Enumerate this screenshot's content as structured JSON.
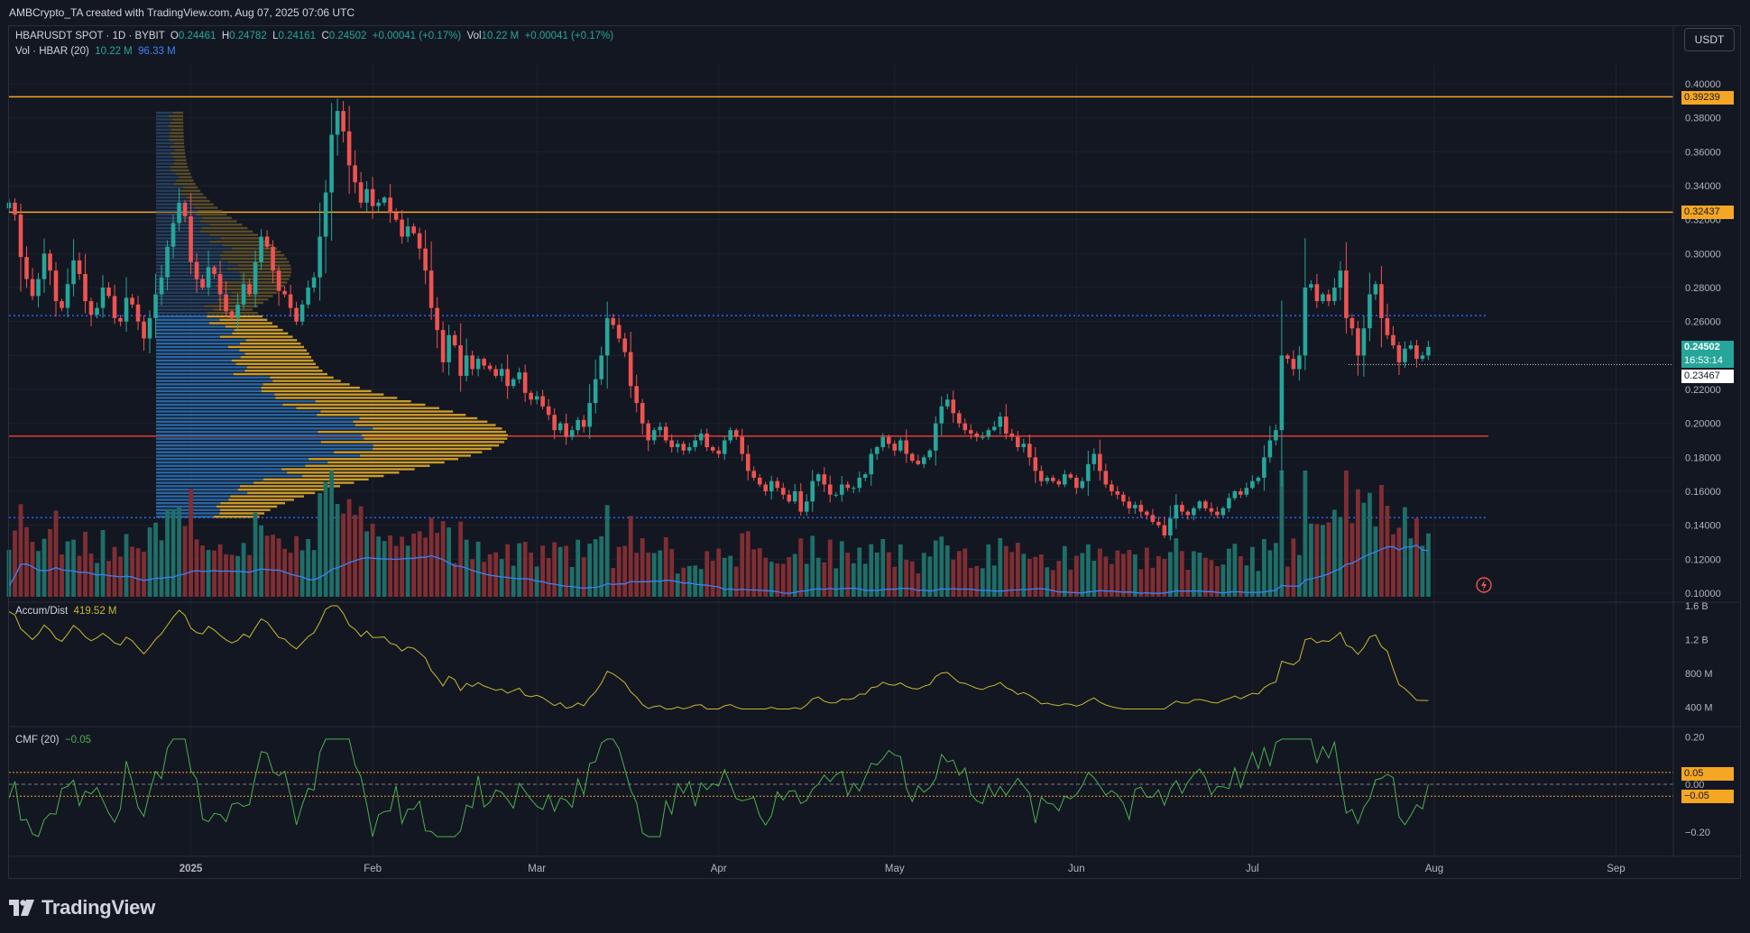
{
  "header": {
    "title": "AMBCrypto_TA created with TradingView.com, Aug 07, 2025 07:06 UTC"
  },
  "legend": {
    "symbol": "HBARUSDT SPOT · 1D · BYBIT",
    "open_label": "O",
    "open": "0.24461",
    "high_label": "H",
    "high": "0.24782",
    "low_label": "L",
    "low": "0.24161",
    "close_label": "C",
    "close": "0.24502",
    "change": "+0.00041 (+0.17%)",
    "vol_label": "Vol",
    "vol": "10.22 M",
    "vol_change": "+0.00041 (+0.17%)",
    "volume_indicator": "Vol · HBAR (20)",
    "volume_value": "10.22 M",
    "volume_ma": "96.33 M",
    "ad_label": "Accum/Dist",
    "ad_value": "419.52 M",
    "cmf_label": "CMF (20)",
    "cmf_value": "−0.05"
  },
  "currency_button": "USDT",
  "brand": "TradingView",
  "colors": {
    "background": "#131722",
    "up": "#26a69a",
    "down": "#ef5350",
    "volume_up": "#1f6e68",
    "volume_down": "#7f2e33",
    "level_orange": "#f5a623",
    "level_red": "#e53935",
    "level_blue_dotted": "#2962ff",
    "ma": "#3b82f6",
    "ad_line": "#c9b930",
    "cmf_line": "#4caf50",
    "vp_blue": "#2c6fb3",
    "vp_yellow": "#d6a22a"
  },
  "price_tags": {
    "level_top": "0.39239",
    "level_mid": "0.32437",
    "last_price": "0.24502",
    "countdown": "16:53:14",
    "support_price": "0.23467",
    "cmf_upper": "0.05",
    "cmf_lower": "−0.05"
  },
  "chart_data": [
    {
      "type": "candlestick",
      "title": "HBARUSDT SPOT · 1D · BYBIT",
      "x_ticks": [
        "2025",
        "Feb",
        "Mar",
        "Apr",
        "May",
        "Jun",
        "Jul",
        "Aug",
        "Sep"
      ],
      "x_tick_dates": [
        "2025-01-01",
        "2025-02-01",
        "2025-03-01",
        "2025-04-01",
        "2025-05-01",
        "2025-06-01",
        "2025-07-01",
        "2025-08-01",
        "2025-09-01"
      ],
      "y_ticks": [
        "0.40000",
        "0.38000",
        "0.36000",
        "0.34000",
        "0.32000",
        "0.30000",
        "0.28000",
        "0.26000",
        "0.24000",
        "0.22000",
        "0.20000",
        "0.18000",
        "0.16000",
        "0.14000",
        "0.12000",
        "0.10000"
      ],
      "ylim": [
        0.1,
        0.4
      ],
      "date_range": [
        "2024-12-01",
        "2025-08-07"
      ],
      "grid": true,
      "horizontal_levels": [
        {
          "price": 0.39239,
          "style": "solid",
          "color": "orange"
        },
        {
          "price": 0.32437,
          "style": "solid",
          "color": "orange"
        },
        {
          "price": 0.2635,
          "style": "dotted",
          "color": "blue"
        },
        {
          "price": 0.1925,
          "style": "solid",
          "color": "red"
        },
        {
          "price": 0.1445,
          "style": "dotted",
          "color": "blue"
        },
        {
          "price": 0.23467,
          "style": "dotted",
          "color": "white"
        }
      ],
      "closes": [
        0.33,
        0.323,
        0.298,
        0.285,
        0.275,
        0.285,
        0.3,
        0.29,
        0.272,
        0.268,
        0.282,
        0.296,
        0.288,
        0.272,
        0.264,
        0.268,
        0.28,
        0.275,
        0.262,
        0.26,
        0.274,
        0.27,
        0.26,
        0.25,
        0.262,
        0.276,
        0.286,
        0.304,
        0.318,
        0.33,
        0.322,
        0.295,
        0.285,
        0.28,
        0.292,
        0.288,
        0.276,
        0.266,
        0.262,
        0.27,
        0.282,
        0.276,
        0.295,
        0.31,
        0.304,
        0.29,
        0.278,
        0.276,
        0.268,
        0.26,
        0.27,
        0.28,
        0.286,
        0.31,
        0.336,
        0.37,
        0.384,
        0.372,
        0.352,
        0.342,
        0.33,
        0.338,
        0.328,
        0.33,
        0.333,
        0.324,
        0.32,
        0.31,
        0.316,
        0.312,
        0.303,
        0.29,
        0.268,
        0.255,
        0.236,
        0.252,
        0.246,
        0.228,
        0.24,
        0.232,
        0.238,
        0.234,
        0.232,
        0.228,
        0.232,
        0.222,
        0.226,
        0.23,
        0.218,
        0.214,
        0.216,
        0.21,
        0.205,
        0.196,
        0.2,
        0.192,
        0.196,
        0.202,
        0.198,
        0.212,
        0.226,
        0.24,
        0.262,
        0.258,
        0.25,
        0.242,
        0.222,
        0.212,
        0.2,
        0.19,
        0.196,
        0.198,
        0.19,
        0.186,
        0.188,
        0.184,
        0.186,
        0.19,
        0.194,
        0.186,
        0.184,
        0.182,
        0.19,
        0.196,
        0.192,
        0.182,
        0.172,
        0.168,
        0.164,
        0.16,
        0.166,
        0.162,
        0.158,
        0.154,
        0.16,
        0.148,
        0.154,
        0.166,
        0.17,
        0.164,
        0.158,
        0.158,
        0.164,
        0.162,
        0.162,
        0.168,
        0.17,
        0.182,
        0.186,
        0.192,
        0.188,
        0.184,
        0.19,
        0.182,
        0.178,
        0.176,
        0.18,
        0.184,
        0.2,
        0.21,
        0.214,
        0.206,
        0.2,
        0.196,
        0.194,
        0.192,
        0.192,
        0.196,
        0.198,
        0.204,
        0.194,
        0.192,
        0.186,
        0.188,
        0.18,
        0.172,
        0.166,
        0.168,
        0.166,
        0.164,
        0.17,
        0.168,
        0.162,
        0.166,
        0.176,
        0.182,
        0.172,
        0.164,
        0.16,
        0.158,
        0.154,
        0.15,
        0.152,
        0.148,
        0.146,
        0.142,
        0.14,
        0.134,
        0.144,
        0.152,
        0.148,
        0.146,
        0.15,
        0.154,
        0.15,
        0.148,
        0.146,
        0.15,
        0.156,
        0.16,
        0.158,
        0.162,
        0.166,
        0.168,
        0.18,
        0.19,
        0.196,
        0.24,
        0.238,
        0.232,
        0.24,
        0.28,
        0.282,
        0.272,
        0.276,
        0.272,
        0.28,
        0.29,
        0.262,
        0.256,
        0.24,
        0.256,
        0.276,
        0.282,
        0.262,
        0.252,
        0.246,
        0.236,
        0.244,
        0.246,
        0.238,
        0.24,
        0.245
      ],
      "volume_scale_max": 140
    },
    {
      "type": "line",
      "title": "Accum/Dist",
      "y_ticks": [
        "1.6 B",
        "1.2 B",
        "800 M",
        "400 M"
      ],
      "ylim": [
        0.3,
        1.6
      ],
      "last_value": "419.52 M"
    },
    {
      "type": "line",
      "title": "CMF (20)",
      "y_ticks": [
        "0.20",
        "0.00",
        "−0.20"
      ],
      "ylim": [
        -0.25,
        0.22
      ],
      "bands": [
        0.05,
        -0.05
      ],
      "last_value": "−0.05"
    }
  ]
}
